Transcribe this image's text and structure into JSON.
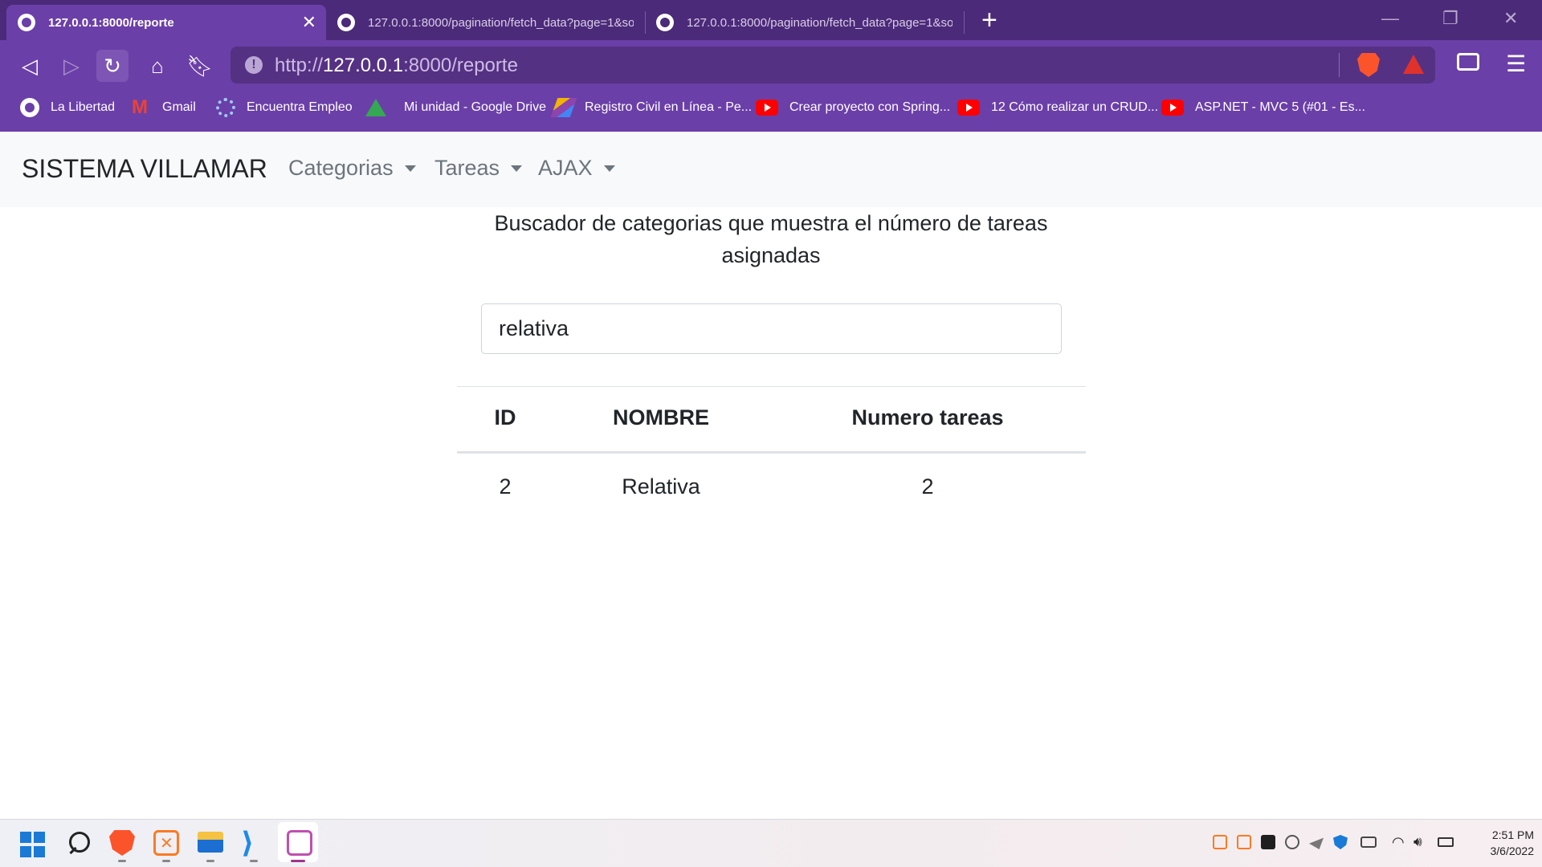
{
  "browser": {
    "tabs": [
      {
        "title": "127.0.0.1:8000/reporte",
        "active": true
      },
      {
        "title": "127.0.0.1:8000/pagination/fetch_data?page=1&sor",
        "active": false
      },
      {
        "title": "127.0.0.1:8000/pagination/fetch_data?page=1&sor",
        "active": false
      }
    ],
    "url_prefix": "http://",
    "url_host": "127.0.0.1",
    "url_rest": ":8000/reporte",
    "bookmarks": [
      {
        "label": "La Libertad",
        "icon": "globe-icon"
      },
      {
        "label": "Gmail",
        "icon": "gmail-icon"
      },
      {
        "label": "Encuentra Empleo",
        "icon": "gear-icon"
      },
      {
        "label": "Mi unidad - Google Drive",
        "icon": "google-drive-icon"
      },
      {
        "label": "Registro Civil en Línea - Pe...",
        "icon": "registro-civil-icon"
      },
      {
        "label": "Crear proyecto con Spring...",
        "icon": "youtube-icon"
      },
      {
        "label": "12 Cómo realizar un CRUD...",
        "icon": "youtube-icon"
      },
      {
        "label": "ASP.NET - MVC 5 (#01 - Es...",
        "icon": "youtube-icon"
      }
    ],
    "accent": "#6b3fa8"
  },
  "navbar": {
    "brand": "SISTEMA VILLAMAR",
    "items": [
      "Categorias",
      "Tareas",
      "AJAX"
    ]
  },
  "main": {
    "heading_line1": "Buscador de categorias que muestra el número de tareas",
    "heading_line2": "asignadas",
    "search_value": "relativa",
    "table": {
      "headers": [
        "ID",
        "NOMBRE",
        "Numero tareas"
      ],
      "rows": [
        [
          "2",
          "Relativa",
          "2"
        ]
      ]
    }
  },
  "taskbar": {
    "time": "2:51 PM",
    "date": "3/6/2022"
  }
}
